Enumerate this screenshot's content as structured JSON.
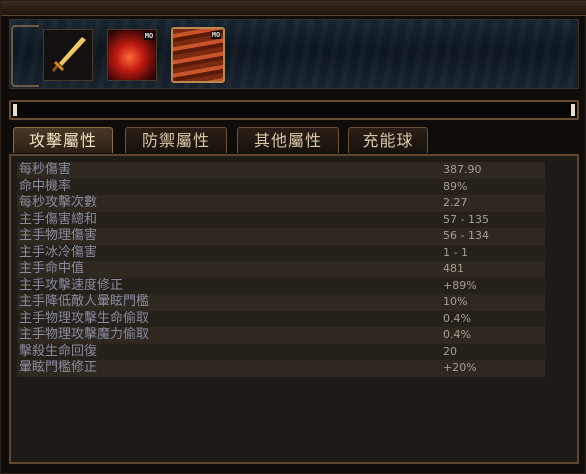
{
  "skills": [
    {
      "name": "sword-skill-icon",
      "badge": ""
    },
    {
      "name": "fire-skill-icon",
      "badge": "MO"
    },
    {
      "name": "flame-card-skill-icon",
      "badge": "MO"
    }
  ],
  "tabs": [
    {
      "label": "攻擊屬性",
      "active": true
    },
    {
      "label": "防禦屬性",
      "active": false
    },
    {
      "label": "其他屬性",
      "active": false
    },
    {
      "label": "充能球",
      "active": false
    }
  ],
  "stats": [
    {
      "label": "每秒傷害",
      "value": "387.90"
    },
    {
      "label": "命中機率",
      "value": "89%"
    },
    {
      "label": "每秒攻擊次數",
      "value": "2.27"
    },
    {
      "label": "主手傷害總和",
      "value": "57 - 135"
    },
    {
      "label": "主手物理傷害",
      "value": "56 - 134"
    },
    {
      "label": "主手冰冷傷害",
      "value": "1 - 1"
    },
    {
      "label": "主手命中值",
      "value": "481"
    },
    {
      "label": "主手攻擊速度修正",
      "value": "+89%"
    },
    {
      "label": "主手降低敵人暈眩門檻",
      "value": "10%"
    },
    {
      "label": "主手物理攻擊生命偷取",
      "value": "0.4%"
    },
    {
      "label": "主手物理攻擊魔力偷取",
      "value": "0.4%"
    },
    {
      "label": "擊殺生命回復",
      "value": "20"
    },
    {
      "label": "暈眩門檻修正",
      "value": "+20%"
    }
  ]
}
